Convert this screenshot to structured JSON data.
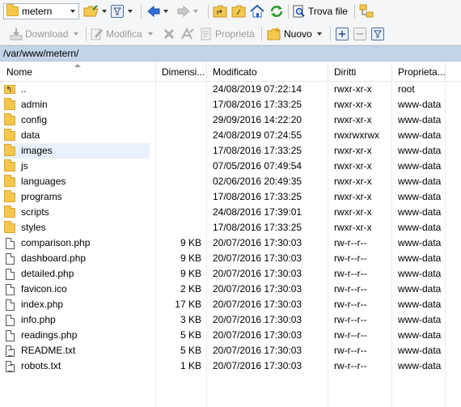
{
  "toolbar1": {
    "directory_selector": "metern",
    "find_files_label": "Trova file",
    "icons": [
      "folder-icon",
      "open-folder-icon",
      "filter-icon",
      "back-arrow-icon",
      "forward-arrow-icon",
      "parent-folder-icon",
      "root-folder-icon",
      "home-icon",
      "refresh-icon",
      "find-files-icon",
      "tree-toggle-icon"
    ]
  },
  "toolbar2": {
    "download_label": "Download",
    "edit_label": "Modifica",
    "properties_label": "Proprietà",
    "new_label": "Nuovo"
  },
  "path": "/var/www/metern/",
  "columns": {
    "name": "Nome",
    "size": "Dimensi...",
    "modified": "Modificato",
    "permissions": "Diritti",
    "owner": "Proprieta..."
  },
  "files": [
    {
      "name": "..",
      "type": "parent",
      "size": "",
      "modified": "24/08/2019 07:22:14",
      "permissions": "rwxr-xr-x",
      "owner": "root"
    },
    {
      "name": "admin",
      "type": "folder",
      "size": "",
      "modified": "17/08/2016 17:33:25",
      "permissions": "rwxr-xr-x",
      "owner": "www-data"
    },
    {
      "name": "config",
      "type": "folder",
      "size": "",
      "modified": "29/09/2016 14:22:20",
      "permissions": "rwxr-xr-x",
      "owner": "www-data"
    },
    {
      "name": "data",
      "type": "folder",
      "size": "",
      "modified": "24/08/2019 07:24:55",
      "permissions": "rwxrwxrwx",
      "owner": "www-data"
    },
    {
      "name": "images",
      "type": "folder",
      "size": "",
      "modified": "17/08/2016 17:33:25",
      "permissions": "rwxr-xr-x",
      "owner": "www-data",
      "selected": true
    },
    {
      "name": "js",
      "type": "folder",
      "size": "",
      "modified": "07/05/2016 07:49:54",
      "permissions": "rwxr-xr-x",
      "owner": "www-data"
    },
    {
      "name": "languages",
      "type": "folder",
      "size": "",
      "modified": "02/06/2016 20:49:35",
      "permissions": "rwxr-xr-x",
      "owner": "www-data"
    },
    {
      "name": "programs",
      "type": "folder",
      "size": "",
      "modified": "17/08/2016 17:33:25",
      "permissions": "rwxr-xr-x",
      "owner": "www-data"
    },
    {
      "name": "scripts",
      "type": "folder",
      "size": "",
      "modified": "24/08/2016 17:39:01",
      "permissions": "rwxr-xr-x",
      "owner": "www-data"
    },
    {
      "name": "styles",
      "type": "folder",
      "size": "",
      "modified": "17/08/2016 17:33:25",
      "permissions": "rwxr-xr-x",
      "owner": "www-data"
    },
    {
      "name": "comparison.php",
      "type": "file",
      "size": "9 KB",
      "modified": "20/07/2016 17:30:03",
      "permissions": "rw-r--r--",
      "owner": "www-data"
    },
    {
      "name": "dashboard.php",
      "type": "file",
      "size": "9 KB",
      "modified": "20/07/2016 17:30:03",
      "permissions": "rw-r--r--",
      "owner": "www-data"
    },
    {
      "name": "detailed.php",
      "type": "file",
      "size": "9 KB",
      "modified": "20/07/2016 17:30:03",
      "permissions": "rw-r--r--",
      "owner": "www-data"
    },
    {
      "name": "favicon.ico",
      "type": "file",
      "size": "2 KB",
      "modified": "20/07/2016 17:30:03",
      "permissions": "rw-r--r--",
      "owner": "www-data"
    },
    {
      "name": "index.php",
      "type": "file",
      "size": "17 KB",
      "modified": "20/07/2016 17:30:03",
      "permissions": "rw-r--r--",
      "owner": "www-data"
    },
    {
      "name": "info.php",
      "type": "file",
      "size": "3 KB",
      "modified": "20/07/2016 17:30:03",
      "permissions": "rw-r--r--",
      "owner": "www-data"
    },
    {
      "name": "readings.php",
      "type": "file",
      "size": "5 KB",
      "modified": "20/07/2016 17:30:03",
      "permissions": "rw-r--r--",
      "owner": "www-data"
    },
    {
      "name": "README.txt",
      "type": "textfile",
      "size": "5 KB",
      "modified": "20/07/2016 17:30:03",
      "permissions": "rw-r--r--",
      "owner": "www-data"
    },
    {
      "name": "robots.txt",
      "type": "textfile",
      "size": "1 KB",
      "modified": "20/07/2016 17:30:03",
      "permissions": "rw-r--r--",
      "owner": "www-data"
    }
  ]
}
